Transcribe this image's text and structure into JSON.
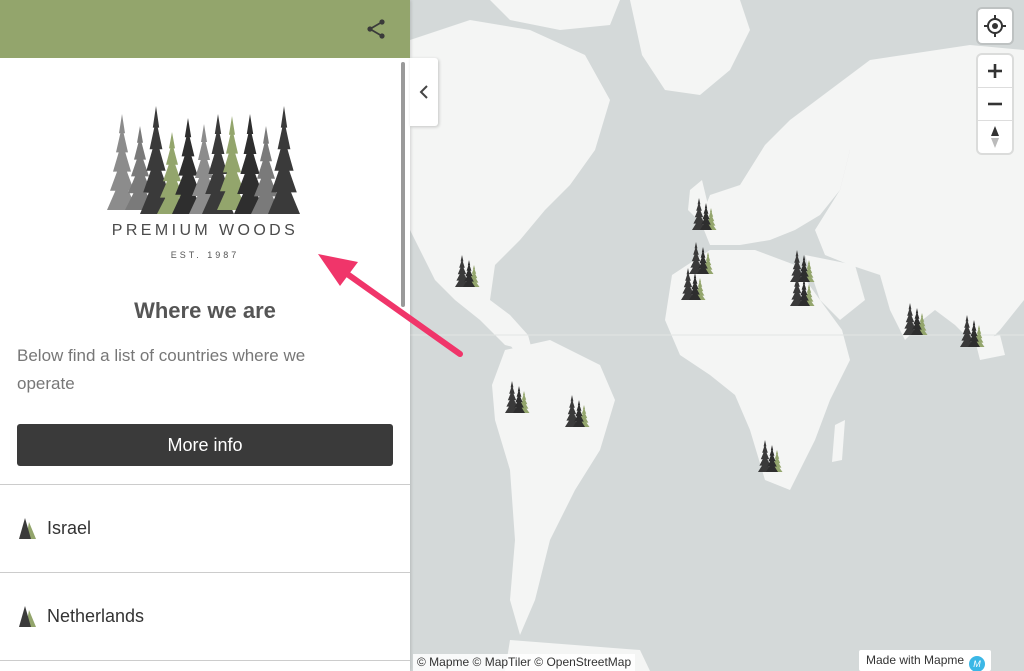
{
  "header": {
    "share_icon": "share-icon",
    "color": "#93a56c"
  },
  "brand": {
    "name": "PREMIUM WOODS",
    "established": "EST. 1987"
  },
  "section": {
    "title": "Where we are",
    "description": "Below find a list of countries where we operate",
    "button_label": "More info"
  },
  "countries": [
    {
      "label": "Israel",
      "icon": "tree-icon"
    },
    {
      "label": "Netherlands",
      "icon": "tree-icon"
    }
  ],
  "map": {
    "attribution": "© Mapme © MapTiler © OpenStreetMap",
    "made_with": "Made with Mapme",
    "made_with_badge": "M",
    "controls": {
      "locate": "locate-icon",
      "zoom_in": "+",
      "zoom_out": "−",
      "compass": "compass-icon"
    },
    "colors": {
      "water": "#d4d9d9",
      "land": "#f4f5f4",
      "tree_dark": "#3a3a3a",
      "tree_light": "#93a56c"
    }
  },
  "annotation": {
    "arrow_color": "#f0356a"
  }
}
